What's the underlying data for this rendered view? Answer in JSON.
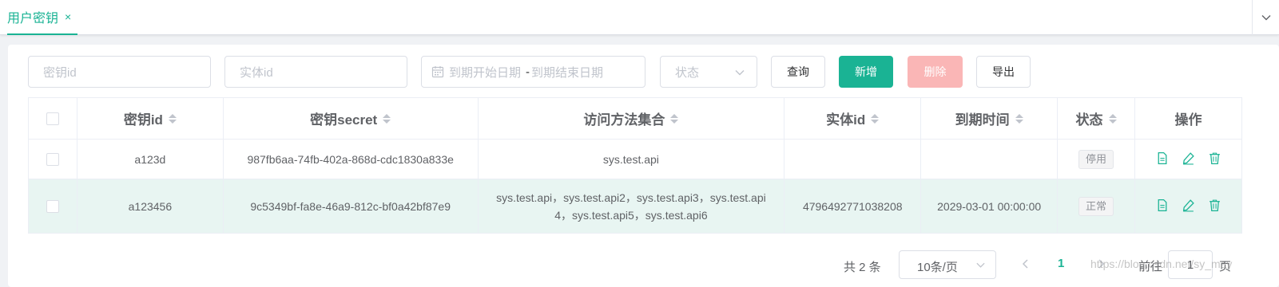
{
  "tab": {
    "label": "用户密钥",
    "close": "×"
  },
  "filters": {
    "key_id_placeholder": "密钥id",
    "entity_id_placeholder": "实体id",
    "date_start_placeholder": "到期开始日期",
    "date_separator": "-",
    "date_end_placeholder": "到期结束日期",
    "status_placeholder": "状态"
  },
  "toolbar": {
    "query_label": "查询",
    "add_label": "新增",
    "delete_label": "删除",
    "export_label": "导出"
  },
  "table": {
    "columns": [
      "密钥id",
      "密钥secret",
      "访问方法集合",
      "实体id",
      "到期时间",
      "状态",
      "操作"
    ],
    "rows": [
      {
        "key_id": "a123d",
        "secret": "987fb6aa-74fb-402a-868d-cdc1830a833e",
        "methods": "sys.test.api",
        "entity_id": "",
        "expire": "",
        "status": "停用"
      },
      {
        "key_id": "a123456",
        "secret": "9c5349bf-fa8e-46a9-812c-bf0a42bf87e9",
        "methods_line1": "sys.test.api，sys.test.api2，sys.test.api3，sys.test.api",
        "methods_line2": "4，sys.test.api5，sys.test.api6",
        "entity_id": "4796492771038208",
        "expire": "2029-03-01 00:00:00",
        "status": "正常"
      }
    ]
  },
  "pagination": {
    "total": "共 2 条",
    "page_size": "10条/页",
    "current_page": "1",
    "goto_label": "前往",
    "goto_value": "1",
    "page_suffix": "页"
  },
  "watermark": "https://blog.csdn.net/sy_may",
  "colors": {
    "accent": "#1ab394",
    "danger_disabled": "#fab6b6",
    "selected_row": "#e8f5f2"
  }
}
